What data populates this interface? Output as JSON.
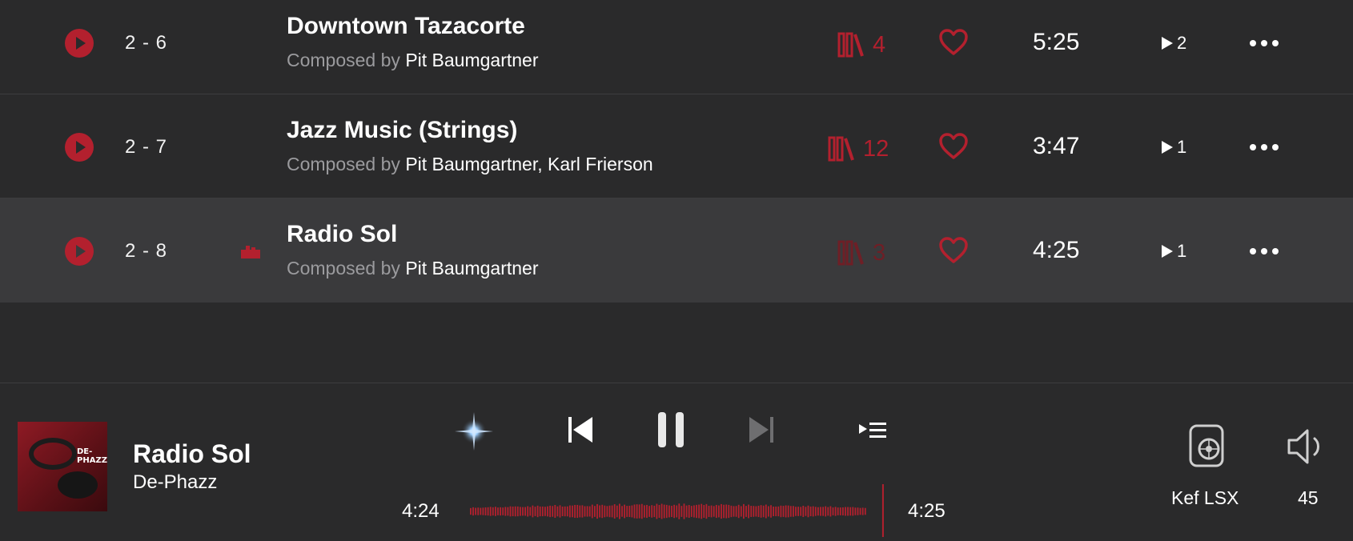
{
  "tracks": [
    {
      "number": "2 - 6",
      "title": "Downtown Tazacorte",
      "credit_prefix": "Composed by",
      "composers": "Pit Baumgartner",
      "library_count": "4",
      "duration": "5:25",
      "plays": "2",
      "playing": false
    },
    {
      "number": "2 - 7",
      "title": "Jazz Music (Strings)",
      "credit_prefix": "Composed by",
      "composers": "Pit Baumgartner, Karl Frierson",
      "library_count": "12",
      "duration": "3:47",
      "plays": "1",
      "playing": false
    },
    {
      "number": "2 - 8",
      "title": "Radio Sol",
      "credit_prefix": "Composed by",
      "composers": "Pit Baumgartner",
      "library_count": "3",
      "duration": "4:25",
      "plays": "1",
      "playing": true
    }
  ],
  "now_playing": {
    "title": "Radio Sol",
    "artist": "De-Phazz",
    "album_art_text": "DE-PHAZZ",
    "elapsed": "4:24",
    "remaining": "4:25",
    "progress": 0.996
  },
  "output": {
    "device": "Kef LSX",
    "volume": "45"
  },
  "colors": {
    "accent": "#b3202e",
    "background": "#2a2a2b",
    "selected_row": "#3a3a3c"
  },
  "icons": [
    "play-circle-icon",
    "now-playing-icon",
    "library-icon",
    "heart-icon",
    "play-count-icon",
    "more-icon",
    "radio-sparkle-icon",
    "previous-icon",
    "pause-icon",
    "next-icon",
    "queue-icon",
    "speaker-device-icon",
    "volume-icon"
  ]
}
